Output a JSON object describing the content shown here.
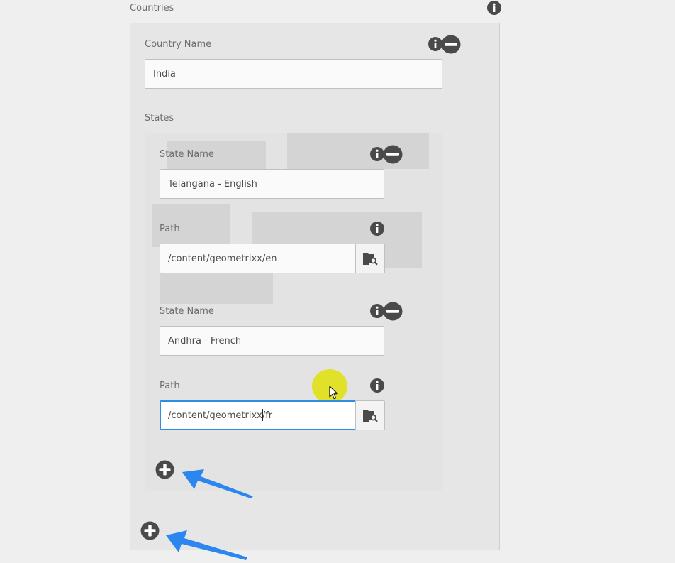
{
  "section_title": "Countries",
  "country": {
    "name_label": "Country Name",
    "name_value": "India",
    "states_label": "States"
  },
  "states": [
    {
      "name_label": "State Name",
      "name_value": "Telangana - English",
      "path_label": "Path",
      "path_value": "/content/geometrixx/en"
    },
    {
      "name_label": "State Name",
      "name_value": "Andhra - French",
      "path_label": "Path",
      "path_value": "/content/geometrixx/fr"
    }
  ],
  "icons": {
    "info": "info-icon",
    "remove": "minus-circle-icon",
    "add": "plus-circle-icon",
    "browse": "folder-search-icon",
    "cursor": "mouse-pointer-icon",
    "annotation": "arrow-annotation"
  },
  "colors": {
    "focus_border": "#2d8ee3",
    "icon_dark": "#4a4a4a",
    "arrow_blue": "#2b86f0",
    "highlight": "#e1e100"
  }
}
